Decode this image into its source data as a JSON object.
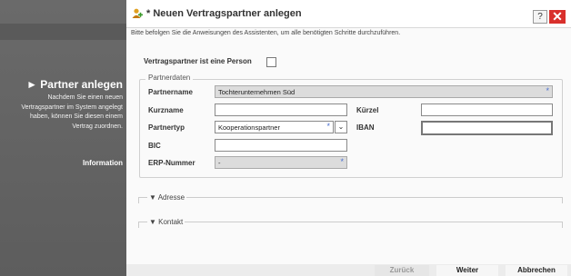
{
  "wizard": {
    "title": "► Partner anlegen",
    "description": "Nachdem Sie einen neuen Vertragspartner im System angelegt haben, können Sie diesen einem Vertrag zuordnen.",
    "info_link": "Information"
  },
  "dialog": {
    "title": "* Neuen Vertragspartner anlegen",
    "subtitle": "Bitte befolgen Sie die Anweisungen des Assistenten, um alle benötigten Schritte durchzuführen.",
    "help_label": "?",
    "close_label": "✕",
    "person_label": "Vertragspartner ist eine Person",
    "person_checked": false
  },
  "partnerdaten": {
    "legend": "Partnerdaten",
    "partnername_label": "Partnername",
    "partnername_value": "Tochterunternehmen Süd",
    "kurzname_label": "Kurzname",
    "kurzname_value": "",
    "kuerzel_label": "Kürzel",
    "kuerzel_value": "",
    "partnertyp_label": "Partnertyp",
    "partnertyp_value": "Kooperationspartner",
    "iban_label": "IBAN",
    "iban_value": "",
    "bic_label": "BIC",
    "bic_value": "",
    "erp_label": "ERP-Nummer",
    "erp_value": "-",
    "required_mark": "*"
  },
  "sections": {
    "adresse": "▼  Adresse",
    "kontakt": "▼  Kontakt"
  },
  "footer": {
    "back": "Zurück",
    "next": "Weiter",
    "cancel": "Abbrechen"
  },
  "colors": {
    "close": "#d9302c",
    "required": "#4a6fd0",
    "side_panel": "#666666"
  }
}
